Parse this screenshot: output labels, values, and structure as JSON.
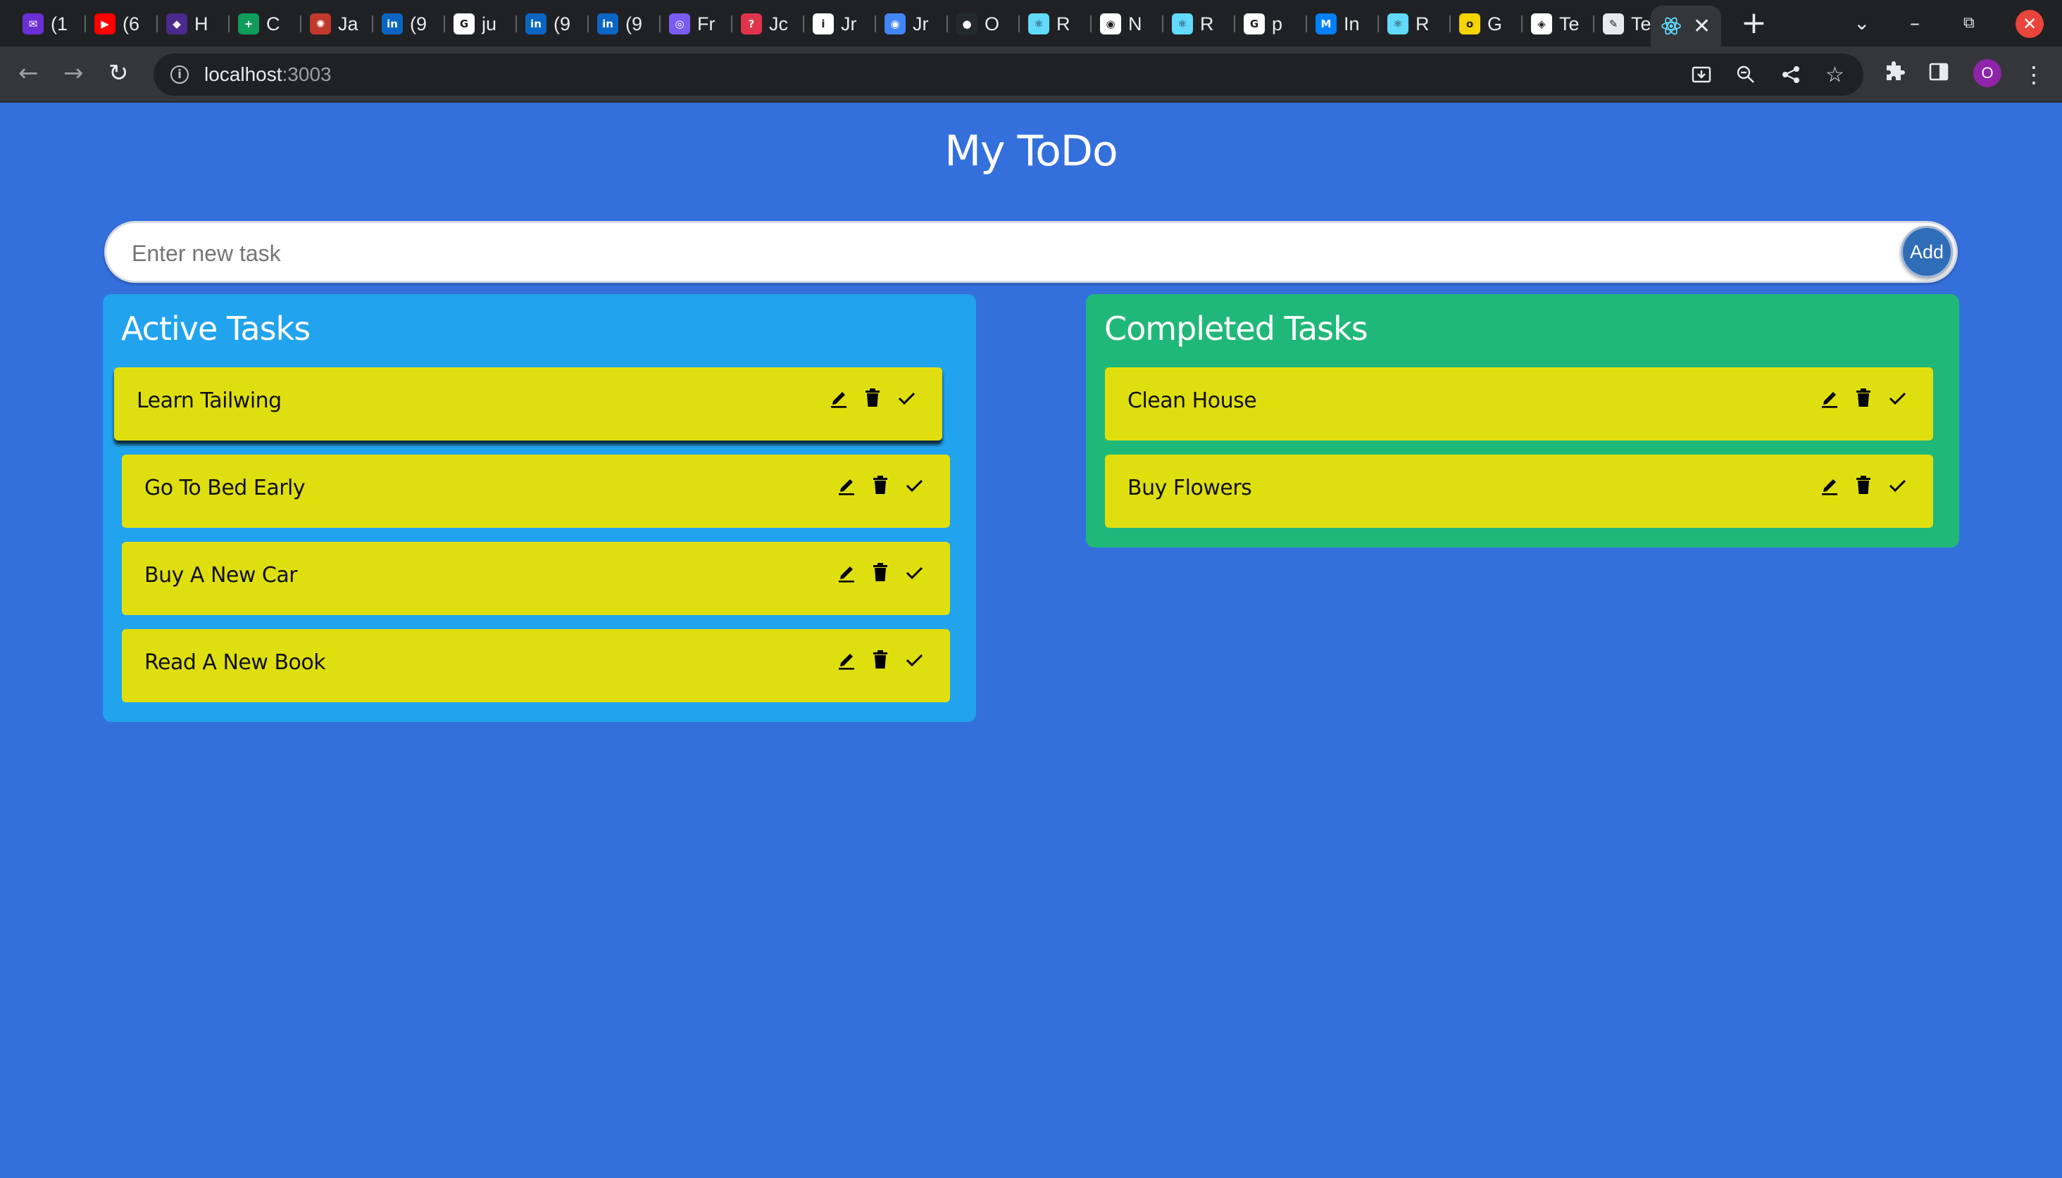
{
  "browser": {
    "tabs": [
      {
        "icon": "mail-icon",
        "title": "(1",
        "color": "#6b2fd6"
      },
      {
        "icon": "youtube-icon",
        "title": "(6",
        "color": "#ff0000"
      },
      {
        "icon": "app-icon",
        "title": "H",
        "color": "#4a2a8a"
      },
      {
        "icon": "sheets-icon",
        "title": "C",
        "color": "#0f9d58"
      },
      {
        "icon": "ai-icon",
        "title": "Ja",
        "color": "#c0392b"
      },
      {
        "icon": "linkedin-icon",
        "title": "(9",
        "color": "#0a66c2"
      },
      {
        "icon": "google-icon",
        "title": "ju",
        "color": "#ffffff"
      },
      {
        "icon": "linkedin-icon",
        "title": "(9",
        "color": "#0a66c2"
      },
      {
        "icon": "linkedin-icon",
        "title": "(9",
        "color": "#0a66c2"
      },
      {
        "icon": "circle-icon",
        "title": "Fr",
        "color": "#7b5cf0"
      },
      {
        "icon": "question-icon",
        "title": "Jc",
        "color": "#e0344a"
      },
      {
        "icon": "info-icon",
        "title": "Jr",
        "color": "#ffffff"
      },
      {
        "icon": "chrome-icon",
        "title": "Jr",
        "color": "#4285f4"
      },
      {
        "icon": "github-icon",
        "title": "O",
        "color": "#24292e"
      },
      {
        "icon": "react-icon",
        "title": "R",
        "color": "#61dafb"
      },
      {
        "icon": "chrome-icon",
        "title": "N",
        "color": "#ffffff"
      },
      {
        "icon": "react-icon",
        "title": "R",
        "color": "#61dafb"
      },
      {
        "icon": "google-icon",
        "title": "p",
        "color": "#ffffff"
      },
      {
        "icon": "mui-icon",
        "title": "In",
        "color": "#007fff"
      },
      {
        "icon": "react-icon",
        "title": "R",
        "color": "#61dafb"
      },
      {
        "icon": "otta-icon",
        "title": "G",
        "color": "#f5d400"
      },
      {
        "icon": "figma-icon",
        "title": "Te",
        "color": "#ffffff"
      },
      {
        "icon": "pen-icon",
        "title": "Te",
        "color": "#e8eaed"
      }
    ],
    "active_tab": {
      "icon": "react-icon",
      "close": "✕",
      "color": "#61dafb"
    },
    "url_host": "localhost",
    "url_port": ":3003",
    "profile_initial": "O"
  },
  "app": {
    "title": "My ToDo",
    "input_placeholder": "Enter new task",
    "input_value": "",
    "add_label": "Add",
    "active": {
      "heading": "Active Tasks",
      "tasks": [
        "Learn Tailwing",
        "Go To Bed Early",
        "Buy A New Car",
        "Read A New Book"
      ]
    },
    "completed": {
      "heading": "Completed Tasks",
      "tasks": [
        "Clean House",
        "Buy Flowers"
      ]
    },
    "colors": {
      "background": "#3470dc",
      "active_panel": "#22a3ee",
      "completed_panel": "#20b879",
      "task_card": "#dfdf10",
      "add_button": "#2f6db6"
    }
  }
}
